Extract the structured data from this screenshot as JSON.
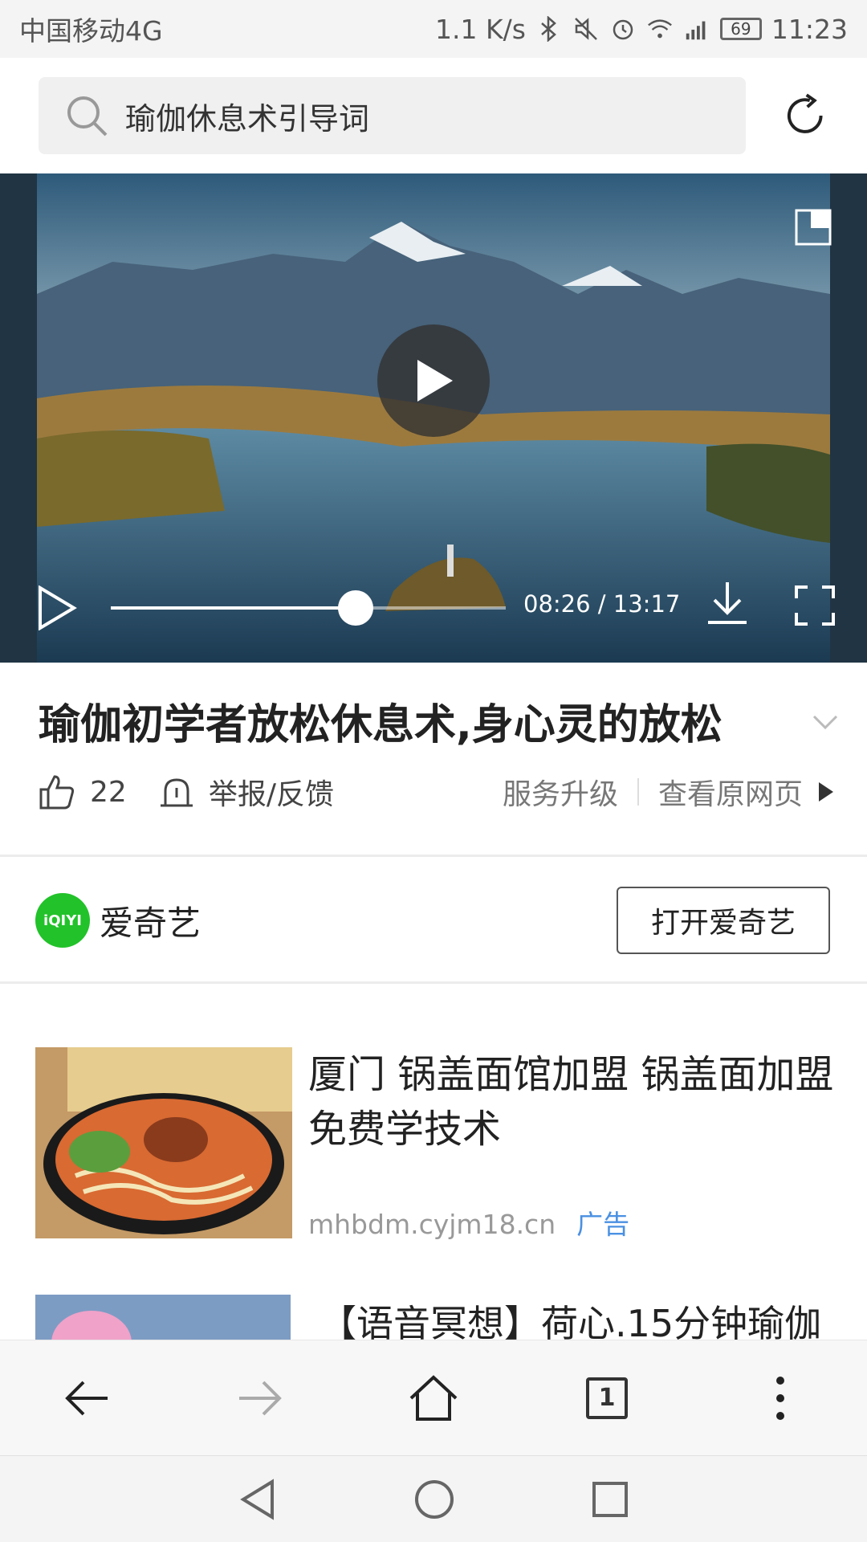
{
  "status_bar": {
    "carrier": "中国移动4G",
    "speed": "1.1 K/s",
    "battery": "69",
    "time": "11:23"
  },
  "search": {
    "query": "瑜伽休息术引导词"
  },
  "video": {
    "time": "08:26 / 13:17",
    "progress": 0.62
  },
  "article": {
    "title": "瑜伽初学者放松休息术,身心灵的放松",
    "like_count": "22",
    "report_label": "举报/反馈",
    "service_label": "服务升级",
    "view_source_label": "查看原网页"
  },
  "source": {
    "logo_text": "iQIYI",
    "name": "爱奇艺",
    "open_button": "打开爱奇艺"
  },
  "ad": {
    "title": "厦门 锅盖面馆加盟 锅盖面加盟免费学技术",
    "domain": "mhbdm.cyjm18.cn",
    "tag": "广告"
  },
  "item2": {
    "title": "【语音冥想】荷心.15分钟瑜伽"
  },
  "nav": {
    "tab_count": "1"
  },
  "colors": {
    "accent_blue": "#4a90e2",
    "iqiyi_green": "#22c22a"
  }
}
